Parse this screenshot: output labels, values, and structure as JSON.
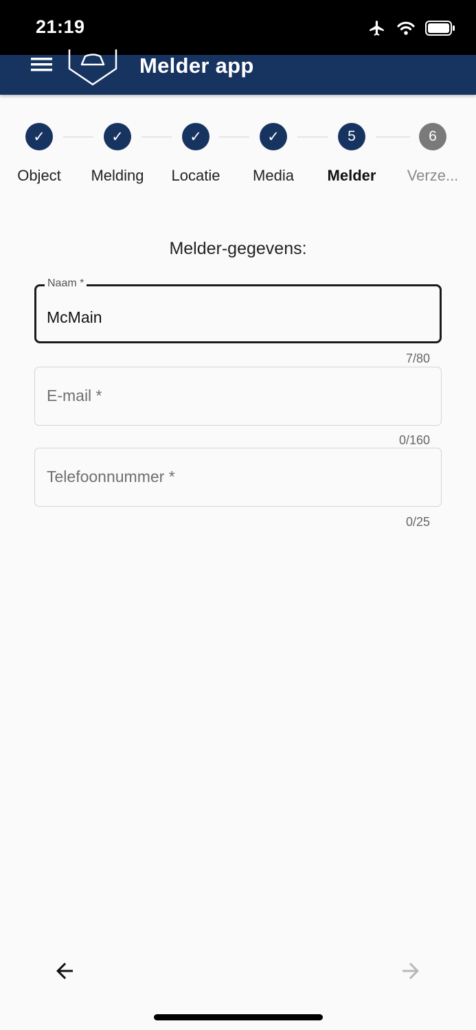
{
  "status_bar": {
    "time": "21:19",
    "icons": [
      "airplane-icon",
      "wifi-icon",
      "battery-icon"
    ]
  },
  "app_bar": {
    "title": "Melder app",
    "menu_icon": "hamburger-menu-icon",
    "logo_icon": "bell-shield-logo"
  },
  "stepper": {
    "steps": [
      {
        "label": "Object",
        "state": "done",
        "marker": "✓"
      },
      {
        "label": "Melding",
        "state": "done",
        "marker": "✓"
      },
      {
        "label": "Locatie",
        "state": "done",
        "marker": "✓"
      },
      {
        "label": "Media",
        "state": "done",
        "marker": "✓"
      },
      {
        "label": "Melder",
        "state": "active",
        "marker": "5"
      },
      {
        "label": "Verze...",
        "state": "pending",
        "marker": "6"
      }
    ]
  },
  "form": {
    "title": "Melder-gegevens:",
    "fields": [
      {
        "label": "Naam *",
        "value": "McMain",
        "counter": "7/80",
        "focused": true
      },
      {
        "label": "E-mail *",
        "value": "",
        "counter": "0/160",
        "focused": false
      },
      {
        "label": "Telefoonnummer *",
        "value": "",
        "counter": "0/25",
        "focused": false
      }
    ]
  },
  "navigation": {
    "back_icon": "arrow-left-icon",
    "next_icon": "arrow-right-icon",
    "next_enabled": false
  },
  "colors": {
    "primary": "#173461",
    "pending": "#7a7a7a",
    "background": "#fafafa"
  }
}
